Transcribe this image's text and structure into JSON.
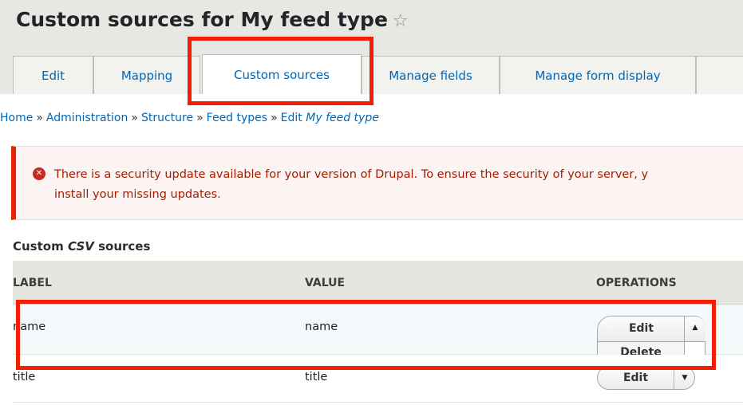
{
  "page": {
    "title": "Custom sources for My feed type",
    "favorite_icon": "star-outline-icon"
  },
  "tabs": [
    {
      "label": "Edit"
    },
    {
      "label": "Mapping"
    },
    {
      "label": "Custom sources",
      "active": true
    },
    {
      "label": "Manage fields"
    },
    {
      "label": "Manage form display"
    }
  ],
  "breadcrumb": {
    "items": [
      "Home",
      "Administration",
      "Structure",
      "Feed types"
    ],
    "separator": "»",
    "edit_prefix": "Edit",
    "edit_target": "My feed type"
  },
  "alert": {
    "icon": "error-circle-icon",
    "line1": "There is a security update available for your version of Drupal. To ensure the security of your server, y",
    "line2": "install your missing updates."
  },
  "section": {
    "title_prefix": "Custom",
    "title_em": "CSV",
    "title_suffix": "sources"
  },
  "table": {
    "headers": {
      "label": "LABEL",
      "value": "VALUE",
      "operations": "OPERATIONS"
    },
    "rows": [
      {
        "label": "name",
        "value": "name",
        "op_primary": "Edit",
        "op_secondary": "Delete",
        "expanded": true
      },
      {
        "label": "title",
        "value": "title",
        "op_primary": "Edit",
        "expanded": false
      }
    ]
  },
  "colors": {
    "link": "#0067b8",
    "highlight": "#f21f06",
    "alert_text": "#a51b00",
    "alert_border": "#e62600"
  }
}
